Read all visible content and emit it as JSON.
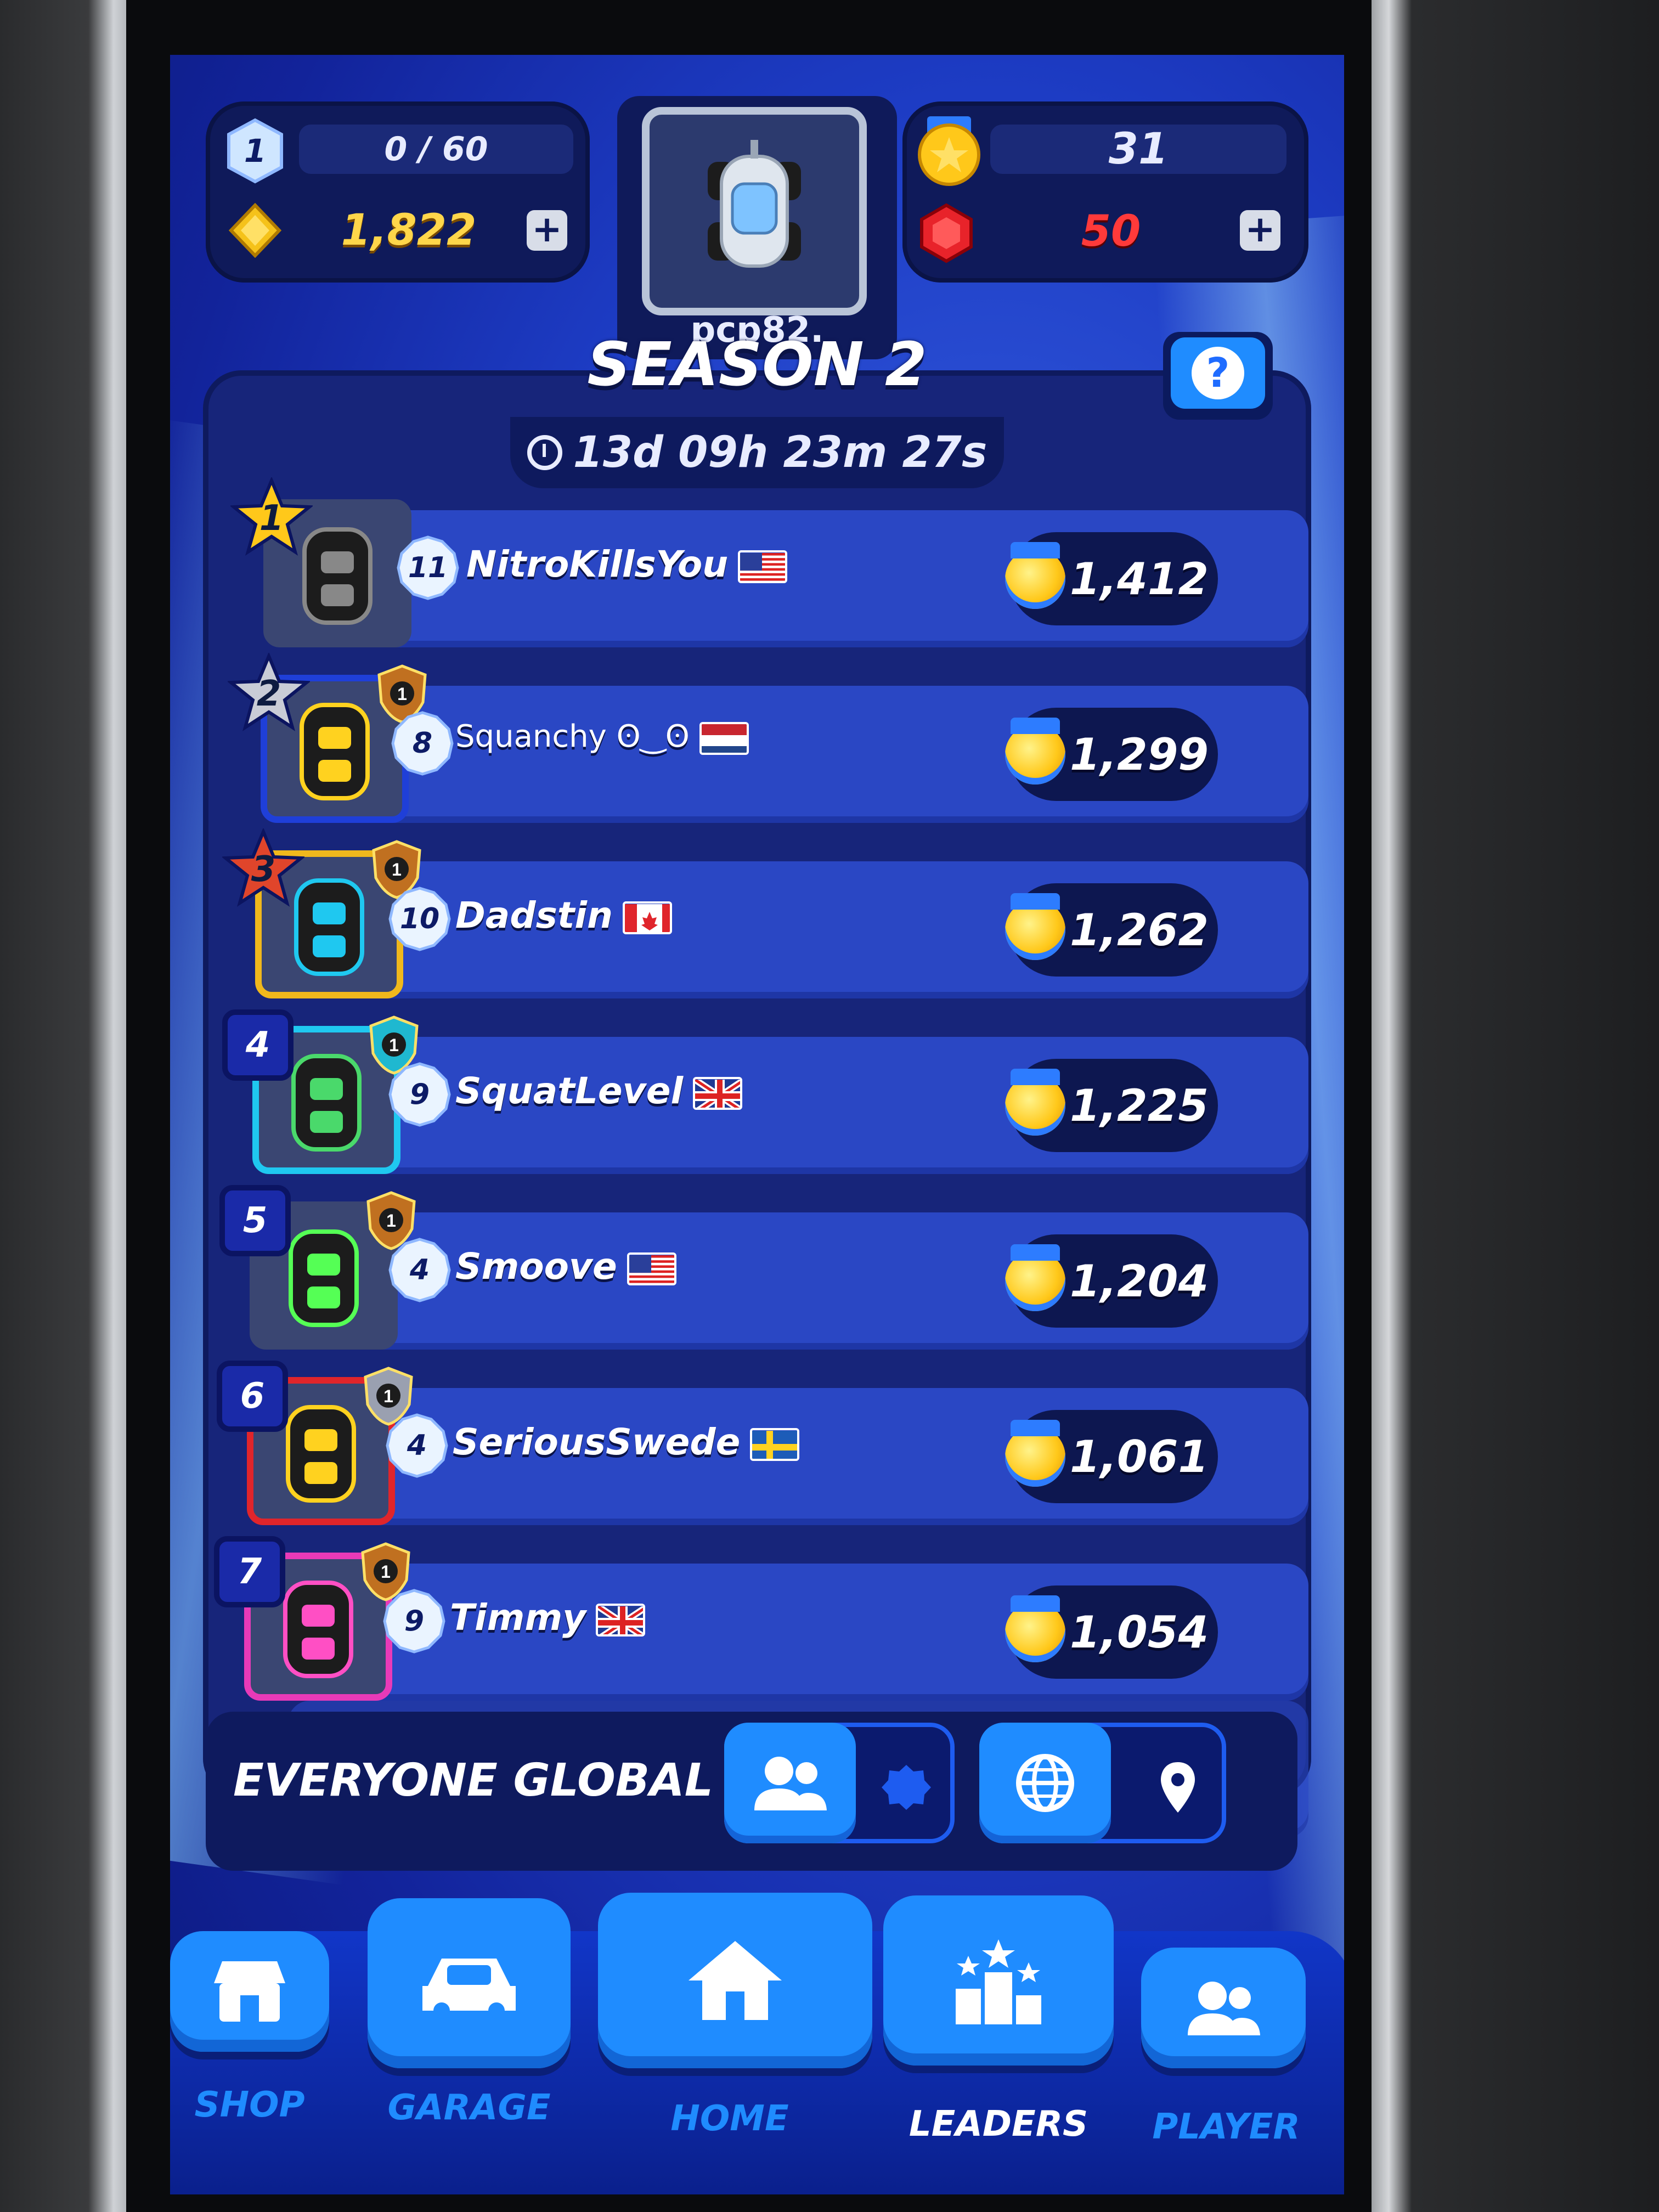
{
  "header": {
    "level": "1",
    "xp": "0 / 60",
    "coins": "1,822",
    "username": "pcp82.",
    "medals": "31",
    "gems": "50"
  },
  "season": {
    "title": "SEASON 2",
    "timer": "13d 09h 23m 27s",
    "help_label": "?"
  },
  "leaderboard": [
    {
      "rank": "1",
      "level": "11",
      "name": "NitroKillsYou",
      "flag": "us",
      "score": "1,412",
      "frame": "#3a4672"
    },
    {
      "rank": "2",
      "level": "8",
      "name": "Squanchy ʘ‿ʘ",
      "flag": "nl",
      "score": "1,299",
      "frame": "#1f3fd8"
    },
    {
      "rank": "3",
      "level": "10",
      "name": "Dadstin",
      "flag": "ca",
      "score": "1,262",
      "frame": "#f0b81c"
    },
    {
      "rank": "4",
      "level": "9",
      "name": "SquatLevel",
      "flag": "gb",
      "score": "1,225",
      "frame": "#1fc8f0"
    },
    {
      "rank": "5",
      "level": "4",
      "name": "Smoove",
      "flag": "us",
      "score": "1,204",
      "frame": "#3a4672"
    },
    {
      "rank": "6",
      "level": "4",
      "name": "SeriousSwede",
      "flag": "se",
      "score": "1,061",
      "frame": "#e0252b"
    },
    {
      "rank": "7",
      "level": "9",
      "name": "Timmy",
      "flag": "gb",
      "score": "1,054",
      "frame": "#e83ab8"
    }
  ],
  "filter": {
    "label": "EVERYONE GLOBAL"
  },
  "nav": {
    "shop": "SHOP",
    "garage": "GARAGE",
    "home": "HOME",
    "leaders": "LEADERS",
    "player": "PLAYER",
    "garage_alert": "!"
  },
  "colors": {
    "accent": "#1f8cff",
    "coin": "#ffd64a",
    "gem": "#ff3a3a"
  }
}
